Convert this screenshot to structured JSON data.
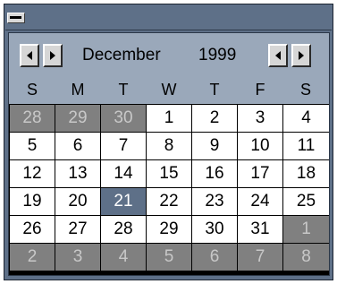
{
  "calendar": {
    "month": "December",
    "year": "1999",
    "weekdays": [
      "S",
      "M",
      "T",
      "W",
      "T",
      "F",
      "S"
    ],
    "selected_day": "21",
    "weeks": [
      [
        {
          "d": "28",
          "o": true
        },
        {
          "d": "29",
          "o": true
        },
        {
          "d": "30",
          "o": true
        },
        {
          "d": "1"
        },
        {
          "d": "2"
        },
        {
          "d": "3"
        },
        {
          "d": "4"
        }
      ],
      [
        {
          "d": "5"
        },
        {
          "d": "6"
        },
        {
          "d": "7"
        },
        {
          "d": "8"
        },
        {
          "d": "9"
        },
        {
          "d": "10"
        },
        {
          "d": "11"
        }
      ],
      [
        {
          "d": "12"
        },
        {
          "d": "13"
        },
        {
          "d": "14"
        },
        {
          "d": "15"
        },
        {
          "d": "16"
        },
        {
          "d": "17"
        },
        {
          "d": "18"
        }
      ],
      [
        {
          "d": "19"
        },
        {
          "d": "20"
        },
        {
          "d": "21",
          "sel": true
        },
        {
          "d": "22"
        },
        {
          "d": "23"
        },
        {
          "d": "24"
        },
        {
          "d": "25"
        }
      ],
      [
        {
          "d": "26"
        },
        {
          "d": "27"
        },
        {
          "d": "28"
        },
        {
          "d": "29"
        },
        {
          "d": "30"
        },
        {
          "d": "31"
        },
        {
          "d": "1",
          "o": true
        }
      ],
      [
        {
          "d": "2",
          "o": true
        },
        {
          "d": "3",
          "o": true
        },
        {
          "d": "4",
          "o": true
        },
        {
          "d": "5",
          "o": true
        },
        {
          "d": "6",
          "o": true
        },
        {
          "d": "7",
          "o": true
        },
        {
          "d": "8",
          "o": true
        }
      ]
    ]
  },
  "icons": {
    "system_menu": "system-menu-icon",
    "prev_month": "arrow-left-icon",
    "next_month": "arrow-right-icon",
    "prev_year": "arrow-left-icon",
    "next_year": "arrow-right-icon"
  },
  "colors": {
    "frame": "#5e7088",
    "header_bg": "#9aa8ba",
    "selected_bg": "#5e7088",
    "other_month_bg": "#808080",
    "other_month_text": "#c8c8c8"
  }
}
